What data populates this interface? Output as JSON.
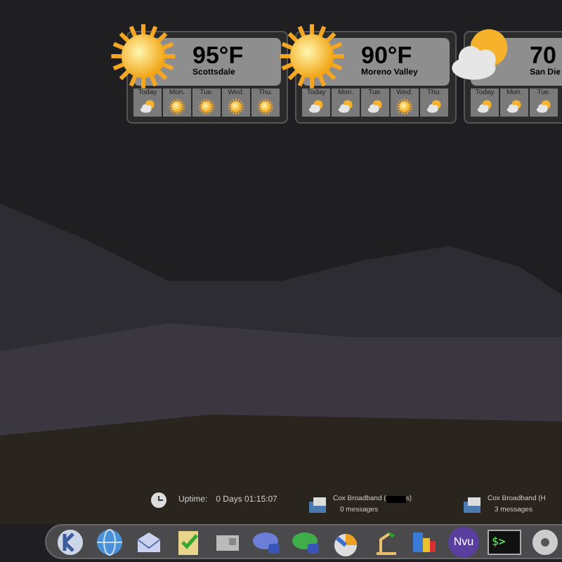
{
  "weather_widgets": [
    {
      "kind": "sunny",
      "temperature": "95°F",
      "city": "Scottsdale",
      "forecast": [
        {
          "day": "Today",
          "kind": "partly-cloudy"
        },
        {
          "day": "Mon.",
          "kind": "sunny"
        },
        {
          "day": "Tue.",
          "kind": "sunny"
        },
        {
          "day": "Wed.",
          "kind": "sunny"
        },
        {
          "day": "Thu.",
          "kind": "sunny"
        }
      ]
    },
    {
      "kind": "sunny",
      "temperature": "90°F",
      "city": "Moreno Valley",
      "forecast": [
        {
          "day": "Today",
          "kind": "partly-cloudy"
        },
        {
          "day": "Mon.",
          "kind": "partly-cloudy"
        },
        {
          "day": "Tue.",
          "kind": "partly-cloudy"
        },
        {
          "day": "Wed.",
          "kind": "sunny"
        },
        {
          "day": "Thu.",
          "kind": "partly-cloudy"
        }
      ]
    },
    {
      "kind": "partly-cloudy",
      "temperature": "70",
      "city": "San Die",
      "forecast": [
        {
          "day": "Today",
          "kind": "partly-cloudy"
        },
        {
          "day": "Mon.",
          "kind": "partly-cloudy"
        },
        {
          "day": "Tue.",
          "kind": "partly-cloudy"
        }
      ]
    }
  ],
  "system_tray": {
    "uptime_label": "Uptime:",
    "uptime_value": "0 Days 01:15:07",
    "mail": [
      {
        "account_start": "Cox Broadband (",
        "account_end": "s)",
        "redacted": true,
        "messages": "0 messages"
      },
      {
        "account_start": "Cox Broadband (H",
        "redacted": false,
        "messages": "3 messages"
      }
    ]
  },
  "dock": [
    {
      "kind": "k-gear"
    },
    {
      "kind": "globe"
    },
    {
      "kind": "envelope"
    },
    {
      "kind": "clipboard"
    },
    {
      "kind": "card"
    },
    {
      "kind": "chat-blue"
    },
    {
      "kind": "chat-green"
    },
    {
      "kind": "pie"
    },
    {
      "kind": "lamp"
    },
    {
      "kind": "puzzle"
    },
    {
      "kind": "text-logo",
      "text": "Nvu"
    },
    {
      "kind": "terminal",
      "text": "$>"
    },
    {
      "kind": "disc"
    }
  ]
}
